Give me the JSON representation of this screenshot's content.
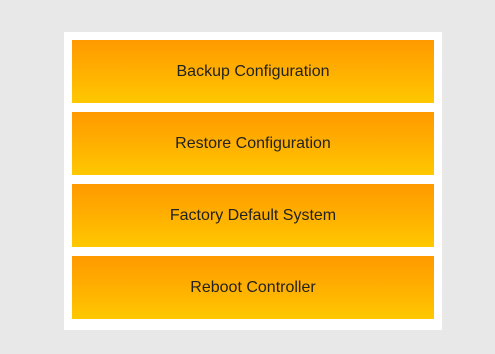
{
  "actions": {
    "backup_label": "Backup Configuration",
    "restore_label": "Restore Configuration",
    "factory_default_label": "Factory Default System",
    "reboot_label": "Reboot Controller"
  }
}
